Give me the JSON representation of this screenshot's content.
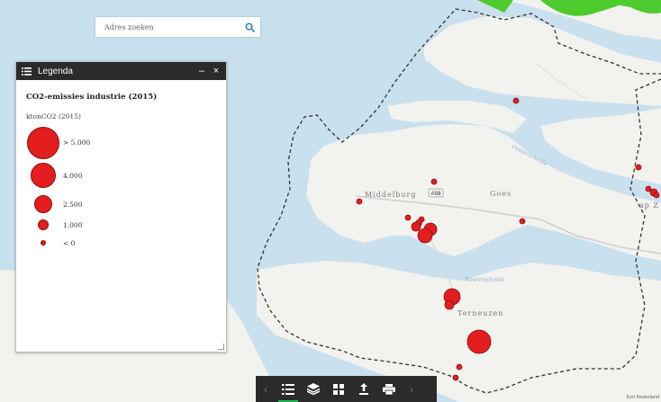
{
  "search": {
    "placeholder": "Adres zoeken"
  },
  "legend": {
    "panel_title": "Legenda",
    "layer_title": "CO2-emissies industrie (2015)",
    "unit": "ktonCO2 (2015)",
    "minimize_symbol": "–",
    "close_symbol": "×",
    "symbol_color": "#e41e1e",
    "items": [
      {
        "label": "> 5.000"
      },
      {
        "label": "4.000"
      },
      {
        "label": "2.500"
      },
      {
        "label": "1.000"
      },
      {
        "label": "< 0"
      }
    ]
  },
  "map": {
    "places": {
      "middelburg": "Middelburg",
      "goes": "Goes",
      "terneuzen": "Terneuzen",
      "zierikzee_fragment": "ap Z"
    },
    "waters": {
      "oosterschelde": "Oosterschelde",
      "westerschelde": "Westerschelde"
    },
    "road_shield": "A58",
    "attribution": "Esri Nederland"
  },
  "toolbar": {
    "prev_icon": "chevron-left-icon",
    "next_icon": "chevron-right-icon",
    "buttons": [
      {
        "icon": "legend-list-icon",
        "active": true
      },
      {
        "icon": "layers-icon",
        "active": false
      },
      {
        "icon": "basemap-grid-icon",
        "active": false
      },
      {
        "icon": "upload-icon",
        "active": false
      },
      {
        "icon": "print-icon",
        "active": false
      }
    ]
  },
  "colors": {
    "water": "#c9e0ee",
    "land": "#f2f2ef",
    "emission_marker": "#e41e1e",
    "toolbar_bg": "#2b2b2b",
    "legend_header_bg": "#2b2b2b",
    "accent": "#24b35a"
  }
}
